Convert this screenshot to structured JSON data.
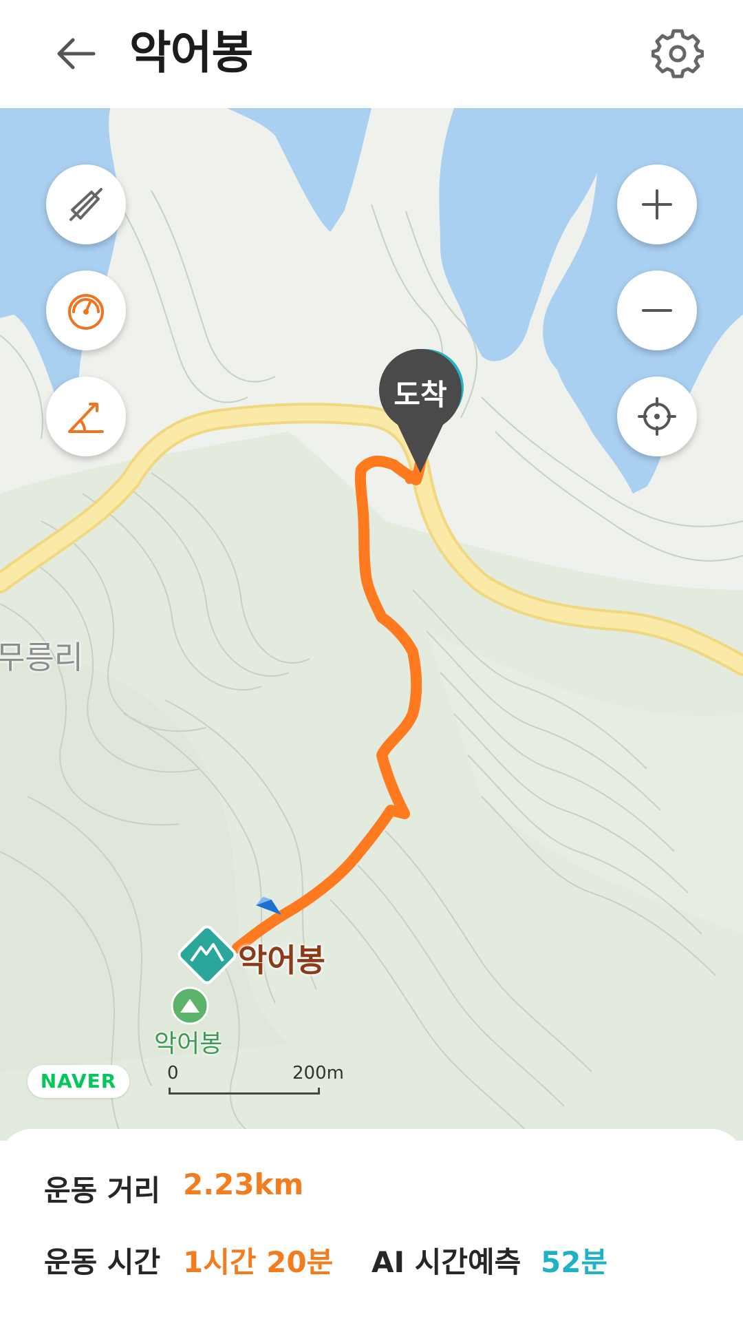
{
  "header": {
    "title": "악어봉",
    "back_icon": "arrow-left-icon",
    "settings_icon": "gear-icon"
  },
  "map": {
    "arrival_marker": "도착",
    "peak_label": "악어봉",
    "peak_sub_label": "악어봉",
    "village_label": "무릉리",
    "provider": "NAVER",
    "scale": {
      "start": "0",
      "end": "200m"
    },
    "controls_left": [
      "compass-off-icon",
      "speedometer-icon",
      "slope-icon"
    ],
    "controls_right": [
      "zoom-in-icon",
      "zoom-out-icon",
      "locate-icon"
    ],
    "colors": {
      "water": "#a9cff1",
      "road": "#fbe9a8",
      "road_edge": "#f1d77e",
      "track": "#ff7a1f",
      "land": "#eef1ec"
    }
  },
  "stats": {
    "distance_label": "운동 거리",
    "distance_value": "2.23km",
    "time_label": "운동 시간",
    "time_value": "1시간 20분",
    "ai_label": "AI 시간예측",
    "ai_value": "52분",
    "colors": {
      "accent_orange": "#f27c1e",
      "accent_teal": "#1fb1c6"
    }
  }
}
